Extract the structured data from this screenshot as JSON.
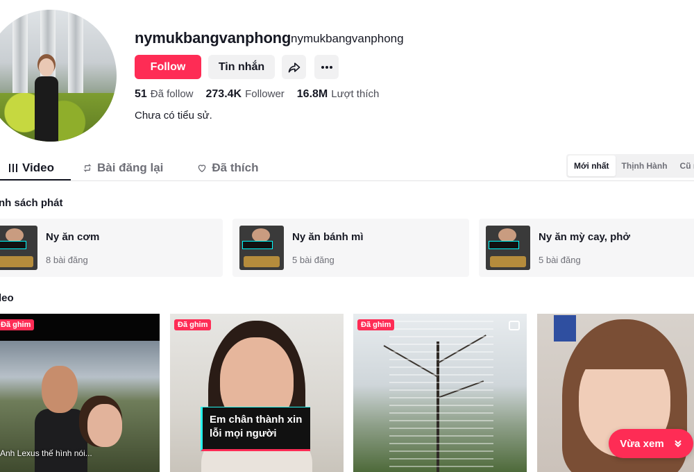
{
  "profile": {
    "username": "nymukbangvanphong",
    "nickname": "nymukbangvanphong",
    "follow_label": "Follow",
    "message_label": "Tin nhắn",
    "stats": [
      {
        "value": "51",
        "label": "Đã follow"
      },
      {
        "value": "273.4K",
        "label": "Follower"
      },
      {
        "value": "16.8M",
        "label": "Lượt thích"
      }
    ],
    "bio": "Chưa có tiểu sử."
  },
  "tabs": [
    {
      "label": "Video",
      "icon": "grid-icon",
      "active": true
    },
    {
      "label": "Bài đăng lại",
      "icon": "repost-icon",
      "active": false
    },
    {
      "label": "Đã thích",
      "icon": "heart-icon",
      "active": false
    }
  ],
  "sort": {
    "options": [
      "Mới nhất",
      "Thịnh Hành",
      "Cũ nhất"
    ],
    "selected": "Mới nhất"
  },
  "sections": {
    "playlists_title": "nh sách phát",
    "videos_title": "leo"
  },
  "playlists": [
    {
      "name": "Ny ăn cơm",
      "count": "8 bài đăng"
    },
    {
      "name": "Ny ăn bánh mì",
      "count": "5 bài đăng"
    },
    {
      "name": "Ny ăn mỳ cay, phở",
      "count": "5 bài đăng"
    }
  ],
  "videos": [
    {
      "pinned_label": "Đã ghim",
      "subtitle": "Anh Lexus thế hình nói..."
    },
    {
      "pinned_label": "Đã ghim",
      "caption_lines": [
        "Em chân thành xin",
        "lỗi mọi người"
      ]
    },
    {
      "pinned_label": "Đã ghim"
    },
    {}
  ],
  "recently_watched_label": "Vừa xem",
  "colors": {
    "accent": "#fe2c55",
    "cyan": "#25f4ee",
    "text": "#161823",
    "muted": "#6e6f77"
  }
}
